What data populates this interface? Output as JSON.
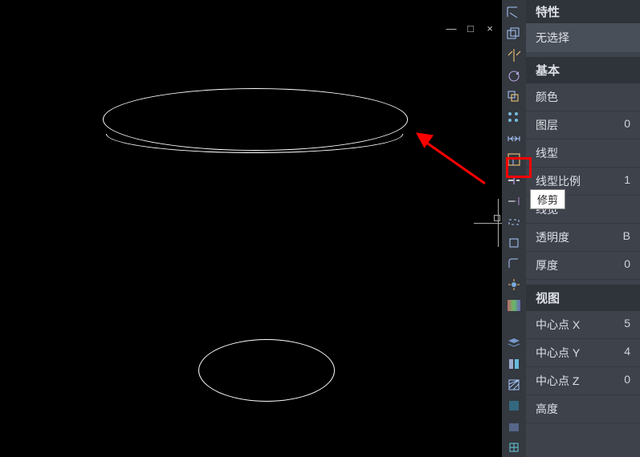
{
  "window": {
    "minimize": "—",
    "maximize": "□",
    "close": "×"
  },
  "tooltip": {
    "text": "修剪"
  },
  "properties": {
    "title": "特性",
    "selection": "无选择",
    "sections": {
      "basic": {
        "title": "基本",
        "color": {
          "label": "颜色",
          "value": ""
        },
        "layer": {
          "label": "图层",
          "value": "0"
        },
        "linetype": {
          "label": "线型",
          "value": ""
        },
        "linetypeScale": {
          "label": "线型比例",
          "value": "1"
        },
        "lineweight": {
          "label": "线宽",
          "value": ""
        },
        "transparency": {
          "label": "透明度",
          "value": "B"
        },
        "thickness": {
          "label": "厚度",
          "value": "0"
        }
      },
      "view": {
        "title": "视图",
        "centerX": {
          "label": "中心点 X",
          "value": "5"
        },
        "centerY": {
          "label": "中心点 Y",
          "value": "4"
        },
        "centerZ": {
          "label": "中心点 Z",
          "value": "0"
        },
        "height": {
          "label": "高度",
          "value": ""
        }
      }
    }
  },
  "toolbar": {
    "icons": [
      "move-icon",
      "copy-icon",
      "mirror-icon",
      "rotate-icon",
      "offset-icon",
      "array-icon",
      "stretch-icon",
      "scale-icon",
      "trim-icon",
      "extend-icon",
      "break-icon",
      "chamfer-icon",
      "fillet-icon",
      "explode-icon",
      "align-icon",
      "point-icon",
      "group-icon",
      "layer-icon",
      "match-icon",
      "hatch-icon",
      "region-icon",
      "block-icon",
      "insert-icon"
    ]
  }
}
